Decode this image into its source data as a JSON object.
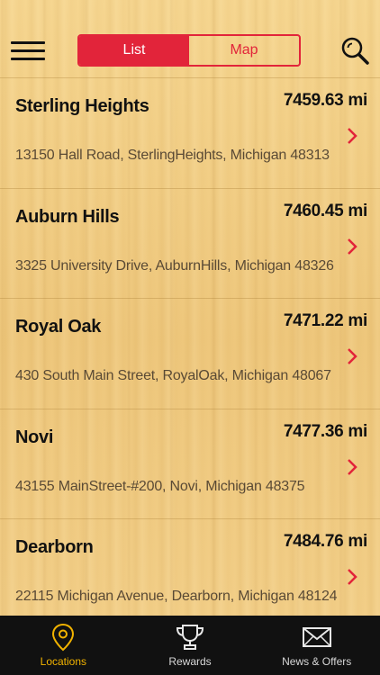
{
  "header": {
    "segments": [
      {
        "label": "List",
        "active": true
      },
      {
        "label": "Map",
        "active": false
      }
    ],
    "menu_icon": "hamburger-menu-icon",
    "search_icon": "search-icon"
  },
  "locations": [
    {
      "name": "Sterling Heights",
      "distance": "7459.63 mi",
      "address": "13150 Hall Road, SterlingHeights, Michigan 48313"
    },
    {
      "name": "Auburn Hills",
      "distance": "7460.45 mi",
      "address": "3325 University Drive, AuburnHills, Michigan 48326"
    },
    {
      "name": "Royal Oak",
      "distance": "7471.22 mi",
      "address": "430 South Main Street, RoyalOak, Michigan 48067"
    },
    {
      "name": "Novi",
      "distance": "7477.36 mi",
      "address": "43155 MainStreet-#200, Novi, Michigan 48375"
    },
    {
      "name": "Dearborn",
      "distance": "7484.76 mi",
      "address": "22115 Michigan Avenue, Dearborn, Michigan 48124"
    }
  ],
  "tabbar": {
    "tabs": [
      {
        "label": "Locations",
        "icon": "location-pin-icon",
        "active": true
      },
      {
        "label": "Rewards",
        "icon": "trophy-icon",
        "active": false
      },
      {
        "label": "News & Offers",
        "icon": "envelope-icon",
        "active": false
      }
    ]
  },
  "colors": {
    "accent_red": "#e2243a",
    "active_tab": "#f2b300",
    "tabbar_bg": "#111111"
  }
}
